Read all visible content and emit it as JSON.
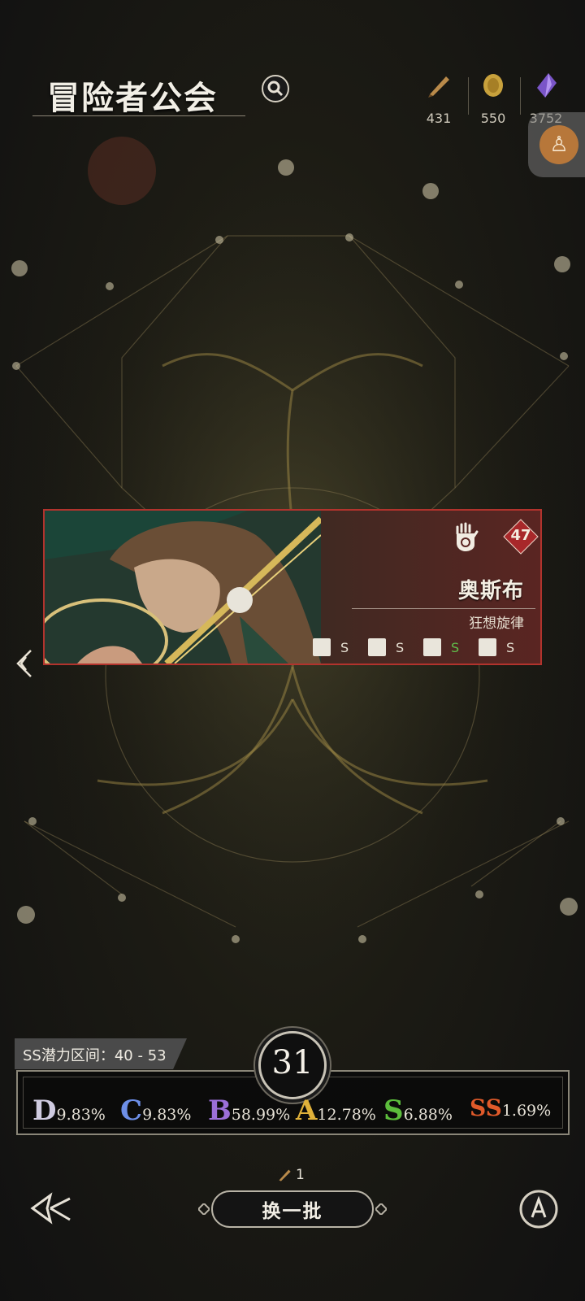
{
  "header": {
    "title": "冒险者公会"
  },
  "resources": [
    {
      "icon": "feather-quill-icon",
      "value": "431"
    },
    {
      "icon": "gold-coin-icon",
      "value": "550"
    },
    {
      "icon": "purple-crystal-icon",
      "value": "3752"
    }
  ],
  "card": {
    "name": "奥斯布",
    "subtitle": "狂想旋律",
    "rank": "47",
    "stats": [
      {
        "icon": "fist-icon",
        "grade": "S"
      },
      {
        "icon": "swirl-icon",
        "grade": "S"
      },
      {
        "icon": "boot-icon",
        "grade": "S",
        "color": "#5fbf4a"
      },
      {
        "icon": "flame-hand-icon",
        "grade": "S"
      }
    ]
  },
  "potential": {
    "range_label": "SS潜力区间：40 - 53",
    "count": "31",
    "rates": [
      {
        "letter": "D",
        "pct": "9.83%",
        "color": "#cfcbe0"
      },
      {
        "letter": "C",
        "pct": "9.83%",
        "color": "#6d8fe8"
      },
      {
        "letter": "B",
        "pct": "58.99%",
        "color": "#9b6fd8"
      },
      {
        "letter": "A",
        "pct": "12.78%",
        "color": "#e0b13a"
      },
      {
        "letter": "S",
        "pct": "6.88%",
        "color": "#5cbd3c"
      },
      {
        "letter": "SS",
        "pct": "1.69%",
        "color": "#e05a2a"
      }
    ]
  },
  "bottom": {
    "cost": "1",
    "refresh_label": "换一批"
  }
}
